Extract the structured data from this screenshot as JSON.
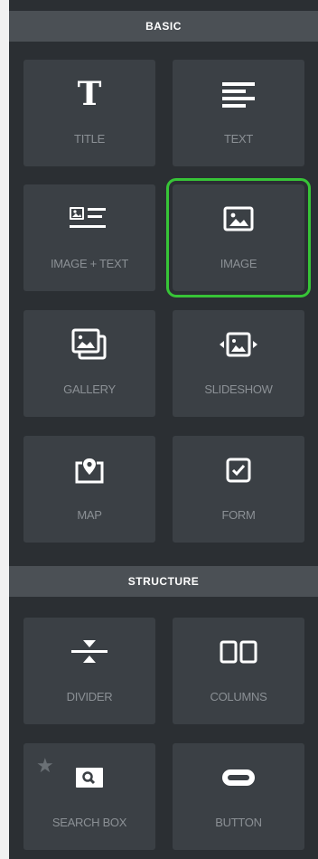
{
  "sections": {
    "basic": {
      "title": "BASIC"
    },
    "structure": {
      "title": "STRUCTURE"
    }
  },
  "tiles": {
    "title": {
      "label": "TITLE",
      "icon": "title-text-icon"
    },
    "text": {
      "label": "TEXT",
      "icon": "text-lines-icon"
    },
    "image_text": {
      "label": "IMAGE + TEXT",
      "icon": "image-text-icon"
    },
    "image": {
      "label": "IMAGE",
      "icon": "image-icon",
      "selected": true
    },
    "gallery": {
      "label": "GALLERY",
      "icon": "gallery-icon"
    },
    "slideshow": {
      "label": "SLIDESHOW",
      "icon": "slideshow-icon"
    },
    "map": {
      "label": "MAP",
      "icon": "map-pin-icon"
    },
    "form": {
      "label": "FORM",
      "icon": "checkbox-form-icon"
    },
    "divider": {
      "label": "DIVIDER",
      "icon": "divider-icon"
    },
    "columns": {
      "label": "COLUMNS",
      "icon": "columns-icon"
    },
    "search_box": {
      "label": "SEARCH BOX",
      "icon": "search-box-icon",
      "premium_star": true
    },
    "button": {
      "label": "BUTTON",
      "icon": "button-pill-icon"
    }
  },
  "colors": {
    "panel_bg": "#2b2f33",
    "tile_bg": "#3b4045",
    "header_bg": "#4b5055",
    "label_text": "#8b9095",
    "icon": "#ffffff",
    "selection_outline": "#37c437"
  }
}
